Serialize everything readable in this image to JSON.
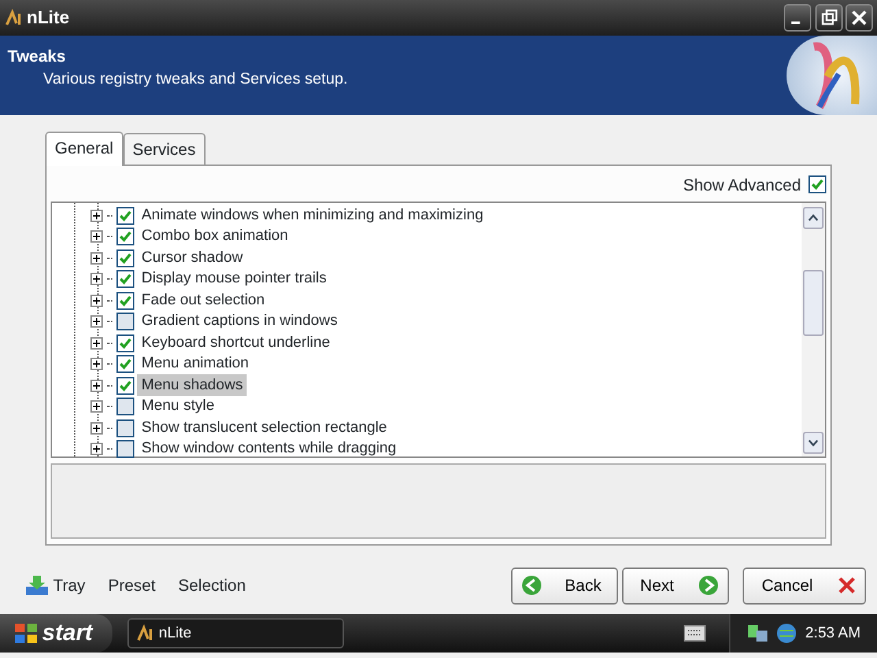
{
  "window": {
    "title": "nLite"
  },
  "header": {
    "title": "Tweaks",
    "subtitle": "Various registry tweaks and Services setup."
  },
  "tabs": [
    {
      "label": "General",
      "selected": true
    },
    {
      "label": "Services",
      "selected": false
    }
  ],
  "show_advanced": {
    "label": "Show Advanced",
    "checked": true
  },
  "tree": {
    "items": [
      {
        "label": "Animate windows when minimizing and maximizing",
        "checked": true,
        "selected": false
      },
      {
        "label": "Combo box animation",
        "checked": true,
        "selected": false
      },
      {
        "label": "Cursor shadow",
        "checked": true,
        "selected": false
      },
      {
        "label": "Display mouse pointer trails",
        "checked": true,
        "selected": false
      },
      {
        "label": "Fade out selection",
        "checked": true,
        "selected": false
      },
      {
        "label": "Gradient captions in windows",
        "checked": false,
        "selected": false
      },
      {
        "label": "Keyboard shortcut underline",
        "checked": true,
        "selected": false
      },
      {
        "label": "Menu animation",
        "checked": true,
        "selected": false
      },
      {
        "label": "Menu shadows",
        "checked": true,
        "selected": true
      },
      {
        "label": "Menu style",
        "checked": false,
        "selected": false
      },
      {
        "label": "Show translucent selection rectangle",
        "checked": false,
        "selected": false
      },
      {
        "label": "Show window contents while dragging",
        "checked": false,
        "selected": false
      }
    ]
  },
  "footer": {
    "links": [
      "Tray",
      "Preset",
      "Selection"
    ],
    "buttons": [
      {
        "label": "Back",
        "kind": "back"
      },
      {
        "label": "Next",
        "kind": "next"
      },
      {
        "label": "Cancel",
        "kind": "cancel"
      }
    ]
  },
  "taskbar": {
    "start": "start",
    "task": "nLite",
    "clock": "2:53 AM"
  }
}
